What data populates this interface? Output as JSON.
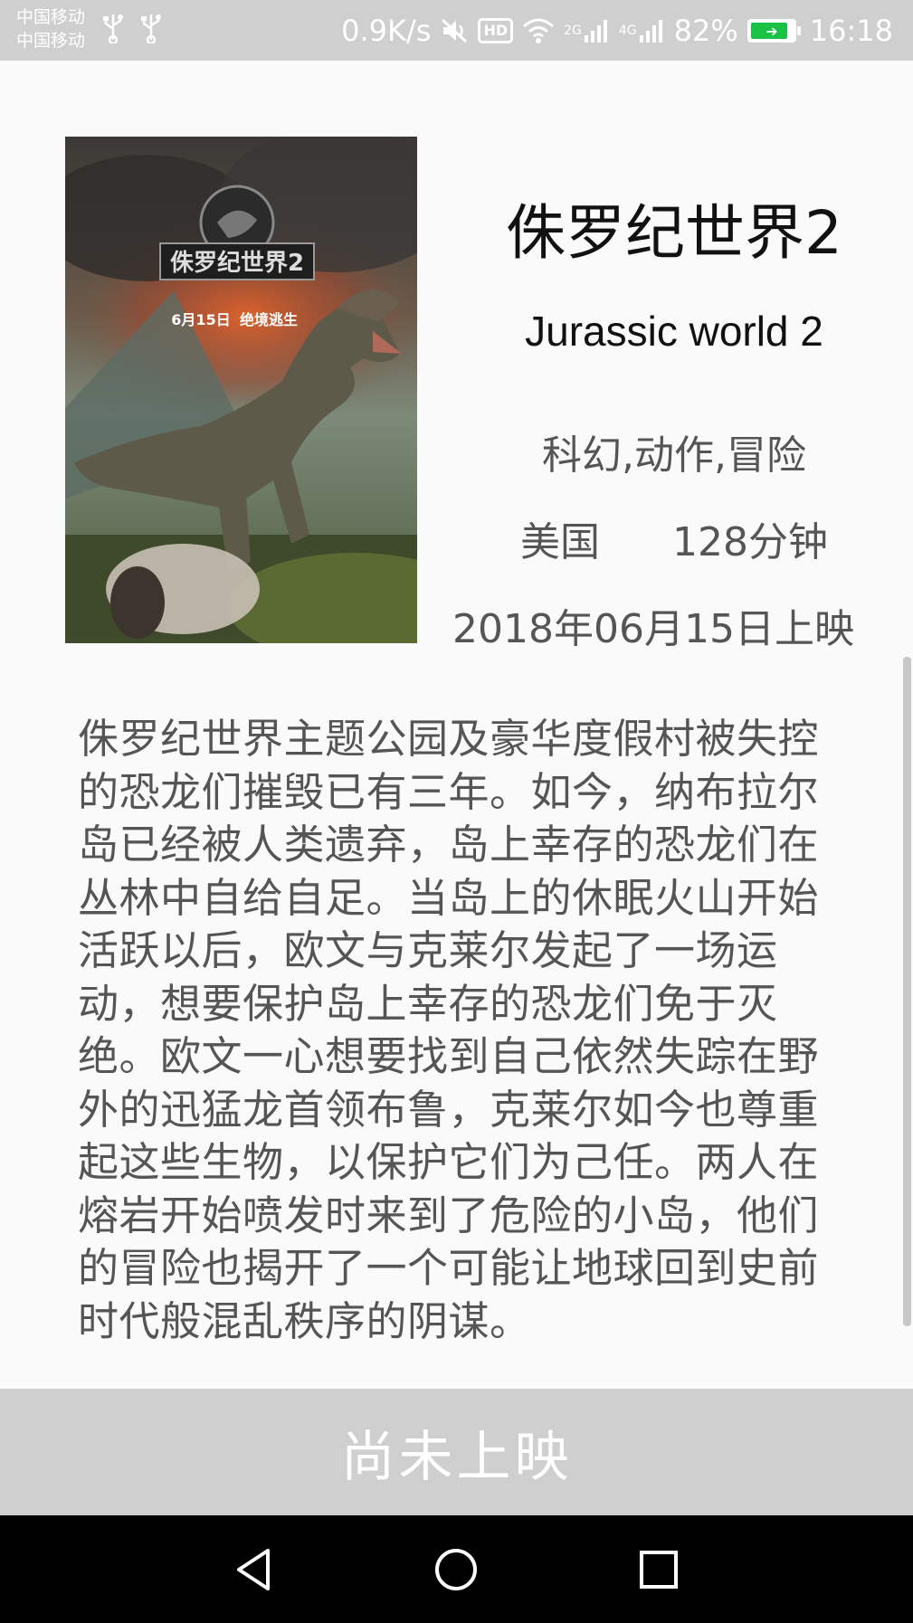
{
  "status_bar": {
    "carrier_1": "中国移动",
    "carrier_2": "中国移动",
    "net_speed": "0.9K/s",
    "hd_label": "HD",
    "sim1_type": "2G",
    "sim2_type": "4G",
    "battery": "82%",
    "time": "16:18",
    "icons": [
      "usb-icon",
      "usb-icon",
      "mute-icon",
      "hd-icon",
      "wifi-icon",
      "signal-icon",
      "signal-icon",
      "battery-icon"
    ]
  },
  "movie": {
    "title": "侏罗纪世界2",
    "english_title": "Jurassic world 2",
    "genres": "科幻,动作,冒险",
    "country": "美国",
    "duration": "128分钟",
    "release": "2018年06月15日上映",
    "poster": {
      "logo_text": "侏罗纪世界2",
      "date_text": "6月15日",
      "tagline": "绝境逃生"
    },
    "synopsis": "侏罗纪世界主题公园及豪华度假村被失控的恐龙们摧毁已有三年。如今，纳布拉尔岛已经被人类遗弃，岛上幸存的恐龙们在丛林中自给自足。当岛上的休眠火山开始活跃以后，欧文与克莱尔发起了一场运动，想要保护岛上幸存的恐龙们免于灭绝。欧文一心想要找到自己依然失踪在野外的迅猛龙首领布鲁，克莱尔如今也尊重起这些生物，以保护它们为己任。两人在熔岩开始喷发时来到了危险的小岛，他们的冒险也揭开了一个可能让地球回到史前时代般混乱秩序的阴谋。"
  },
  "action_button": {
    "label": "尚未上映"
  },
  "nav_bar": {
    "icons": [
      "back-icon",
      "home-icon",
      "recents-icon"
    ]
  }
}
